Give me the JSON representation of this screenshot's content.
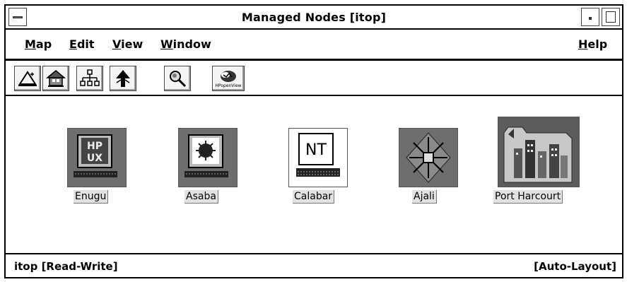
{
  "window": {
    "title": "Managed Nodes [itop]"
  },
  "menubar": {
    "items": [
      {
        "label": "Map",
        "mnemonic": "M"
      },
      {
        "label": "Edit",
        "mnemonic": "E"
      },
      {
        "label": "View",
        "mnemonic": "V"
      },
      {
        "label": "Window",
        "mnemonic": "W"
      },
      {
        "label": "Help",
        "mnemonic": "H"
      }
    ]
  },
  "toolbar": {
    "tools": [
      {
        "icon": "new-submap-icon"
      },
      {
        "icon": "home-icon"
      },
      {
        "icon": "network-tree-icon"
      },
      {
        "icon": "up-arrow-icon"
      },
      {
        "icon": "zoom-search-icon"
      },
      {
        "icon": "hp-logo-icon",
        "caption": "HPopenView"
      }
    ]
  },
  "nodes": [
    {
      "label": "Enugu",
      "icon": "hp-ux-workstation-icon",
      "badge": "HP UX",
      "color": "#707070"
    },
    {
      "label": "Asaba",
      "icon": "sun-workstation-icon",
      "color": "#707070"
    },
    {
      "label": "Calabar",
      "icon": "nt-workstation-icon",
      "badge": "NT",
      "color": "#ffffff"
    },
    {
      "label": "Ajali",
      "icon": "network-hub-icon",
      "color": "#707070"
    },
    {
      "label": "Port Harcourt",
      "icon": "city-folder-icon",
      "color": "#5c5c5c"
    }
  ],
  "statusbar": {
    "left": "itop [Read-Write]",
    "right": "[Auto-Layout]"
  }
}
